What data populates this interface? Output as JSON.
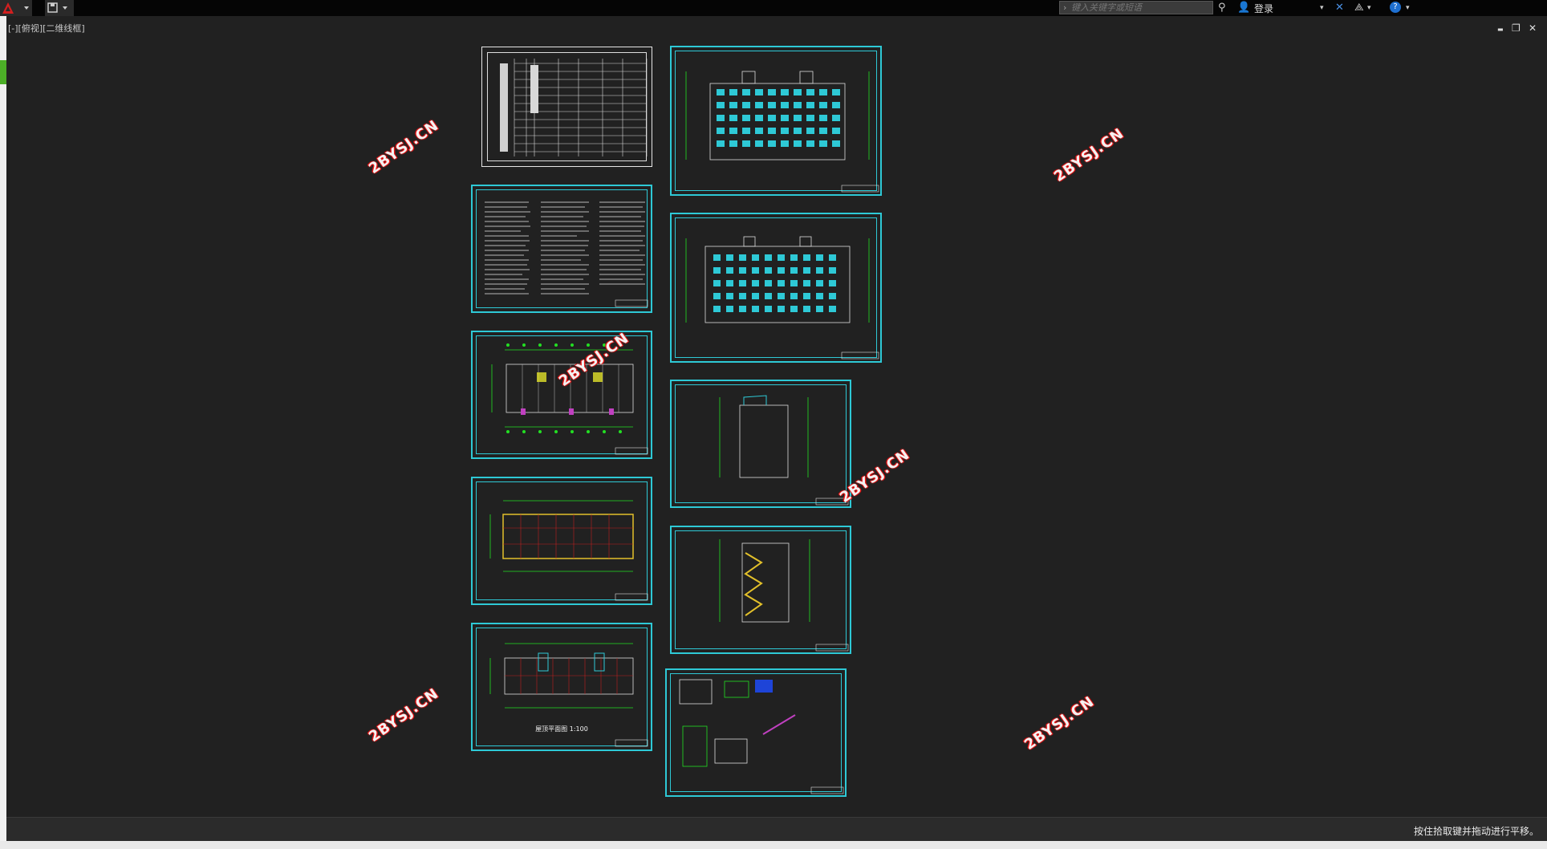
{
  "titlebar": {
    "search_placeholder": "键入关键字或短语",
    "login_label": "登录",
    "help_icon": "?"
  },
  "viewport": {
    "label": "[-][俯视][二维线框]"
  },
  "window_controls": {
    "minimize": "▬",
    "restore": "❐",
    "close": "✕"
  },
  "statusbar": {
    "message": "按住拾取键并拖动进行平移。"
  },
  "watermark": {
    "text": "2BYSJ.CN"
  },
  "sheets": {
    "plan_caption": "屋顶平面图 1:100"
  },
  "colors": {
    "accent_cyan": "#2ec9d6",
    "cad_green": "#22e022",
    "watermark_red": "#e01010"
  }
}
